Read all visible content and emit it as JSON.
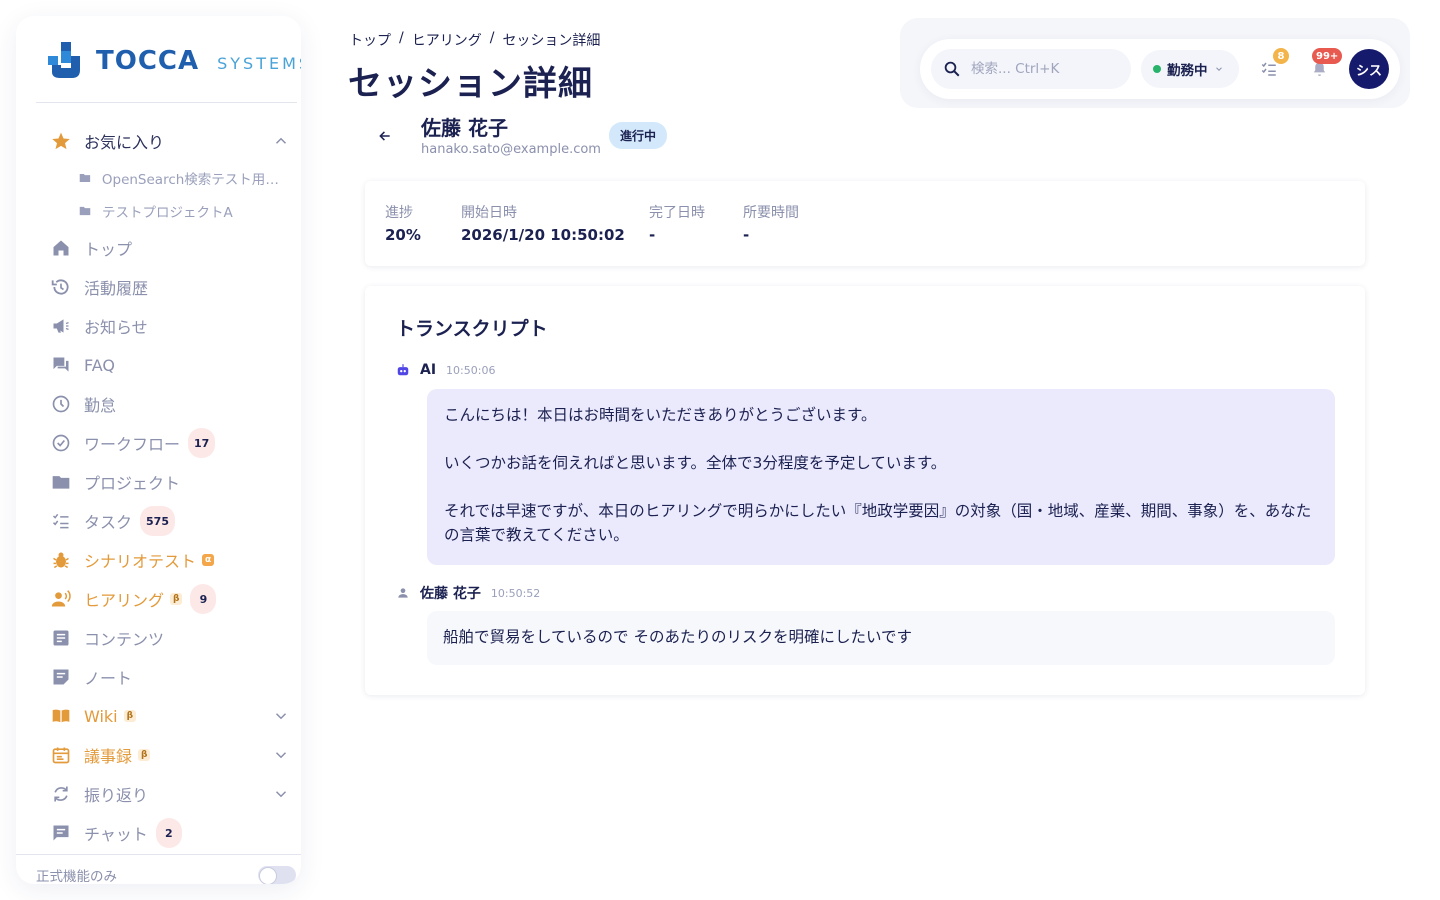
{
  "sidebar": {
    "logo": {
      "brand": "TOCCA",
      "sub": "SYSTEMS"
    },
    "favorites": {
      "label": "お気に入り",
      "items": [
        "OpenSearch検索テスト用プ...",
        "テストプロジェクトA"
      ]
    },
    "items": [
      {
        "label": "トップ",
        "icon": "home-icon"
      },
      {
        "label": "活動履歴",
        "icon": "history-icon"
      },
      {
        "label": "お知らせ",
        "icon": "megaphone-icon"
      },
      {
        "label": "FAQ",
        "icon": "forum-icon"
      },
      {
        "label": "勤怠",
        "icon": "clock-icon"
      },
      {
        "label": "ワークフロー",
        "icon": "check-circle-icon",
        "count": "17"
      },
      {
        "label": "プロジェクト",
        "icon": "folder-icon"
      },
      {
        "label": "タスク",
        "icon": "checklist-icon",
        "count": "575"
      },
      {
        "label": "シナリオテスト",
        "icon": "bug-icon",
        "tag": "α"
      },
      {
        "label": "ヒアリング",
        "icon": "voice-icon",
        "tag": "β",
        "count": "9"
      },
      {
        "label": "コンテンツ",
        "icon": "article-icon"
      },
      {
        "label": "ノート",
        "icon": "note-icon"
      },
      {
        "label": "Wiki",
        "icon": "book-icon",
        "tag": "β"
      },
      {
        "label": "議事録",
        "icon": "calendar-icon",
        "tag": "β"
      },
      {
        "label": "振り返り",
        "icon": "refresh-icon"
      },
      {
        "label": "チャット",
        "icon": "chat-icon",
        "count": "2"
      }
    ],
    "footer": {
      "label": "正式機能のみ"
    }
  },
  "header": {
    "breadcrumb": [
      "トップ",
      "ヒアリング",
      "セッション詳細"
    ],
    "title": "セッション詳細",
    "search": {
      "placeholder": "検索... Ctrl+K"
    },
    "status": "勤務中",
    "tasks_badge": "8",
    "notifications_badge": "99+",
    "avatar": "シス"
  },
  "session": {
    "name": "佐藤 花子",
    "email": "hanako.sato@example.com",
    "status": "進行中",
    "stats": [
      {
        "label": "進捗",
        "value": "20%"
      },
      {
        "label": "開始日時",
        "value": "2026/1/20 10:50:02"
      },
      {
        "label": "完了日時",
        "value": "-"
      },
      {
        "label": "所要時間",
        "value": "-"
      }
    ]
  },
  "transcript": {
    "title": "トランスクリプト",
    "messages": [
      {
        "sender": "AI",
        "time": "10:50:06",
        "paragraphs": [
          "こんにちは！本日はお時間をいただきありがとうございます。",
          "いくつかお話を伺えればと思います。全体で3分程度を予定しています。",
          "それでは早速ですが、本日のヒアリングで明らかにしたい『地政学要因』の対象（国・地域、産業、期間、事象）を、あなたの言葉で教えてください。"
        ]
      },
      {
        "sender": "佐藤 花子",
        "time": "10:50:52",
        "paragraphs": [
          "船舶で貿易をしているので そのあたりのリスクを明確にしたいです"
        ]
      }
    ]
  },
  "colors": {
    "navy": "#1b2150",
    "accent_orange": "#e39a3a",
    "ai_bubble": "#ebe9fc",
    "status_badge": "#d3e9fb",
    "avatar": "#161a6c"
  }
}
